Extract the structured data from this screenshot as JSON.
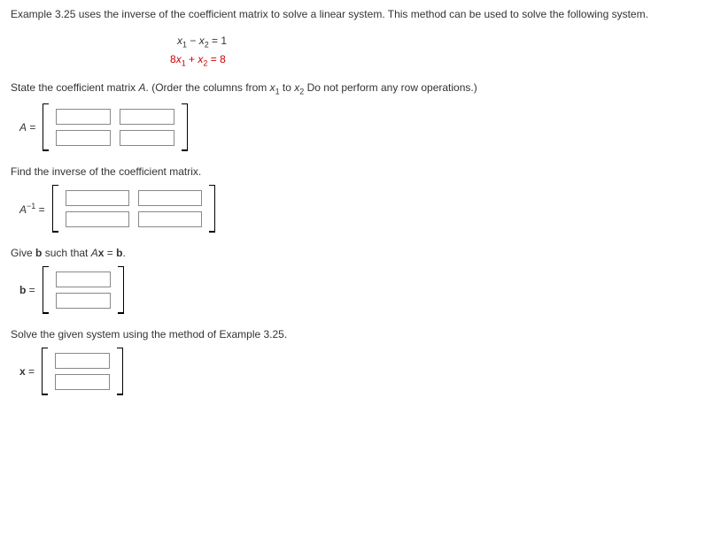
{
  "intro": "Example 3.25 uses the inverse of the coefficient matrix to solve a linear system. This method can be used to solve the following system.",
  "equations": {
    "line1_lhs_a": "x",
    "line1_sub_a": "1",
    "line1_op": " − ",
    "line1_lhs_b": "x",
    "line1_sub_b": "2",
    "line1_eq": " = ",
    "line1_rhs": "1",
    "line2_coef": "8",
    "line2_lhs_a": "x",
    "line2_sub_a": "1",
    "line2_op": " + ",
    "line2_lhs_b": "x",
    "line2_sub_b": "2",
    "line2_eq": " = ",
    "line2_rhs": "8"
  },
  "prompt_A_pre": "State the coefficient matrix ",
  "prompt_A_var": "A",
  "prompt_A_mid": ". (Order the columns from ",
  "prompt_A_x1": "x",
  "prompt_A_sub1": "1",
  "prompt_A_to": " to ",
  "prompt_A_x2": "x",
  "prompt_A_sub2": "2",
  "prompt_A_post": " Do not perform any row operations.)",
  "label_A_var": "A",
  "label_A_eq": " = ",
  "prompt_inv": "Find the inverse of the coefficient matrix.",
  "label_Ainv_var": "A",
  "label_Ainv_sup": "−1",
  "label_Ainv_eq": " = ",
  "prompt_b_pre": "Give ",
  "prompt_b_b": "b",
  "prompt_b_mid": " such that ",
  "prompt_b_A": "A",
  "prompt_b_x": "x",
  "prompt_b_eq": " = ",
  "prompt_b_b2": "b",
  "prompt_b_post": ".",
  "label_b_var": "b",
  "label_b_eq": " = ",
  "prompt_solve": "Solve the given system using the method of Example 3.25.",
  "label_x_var": "x",
  "label_x_eq": " = "
}
